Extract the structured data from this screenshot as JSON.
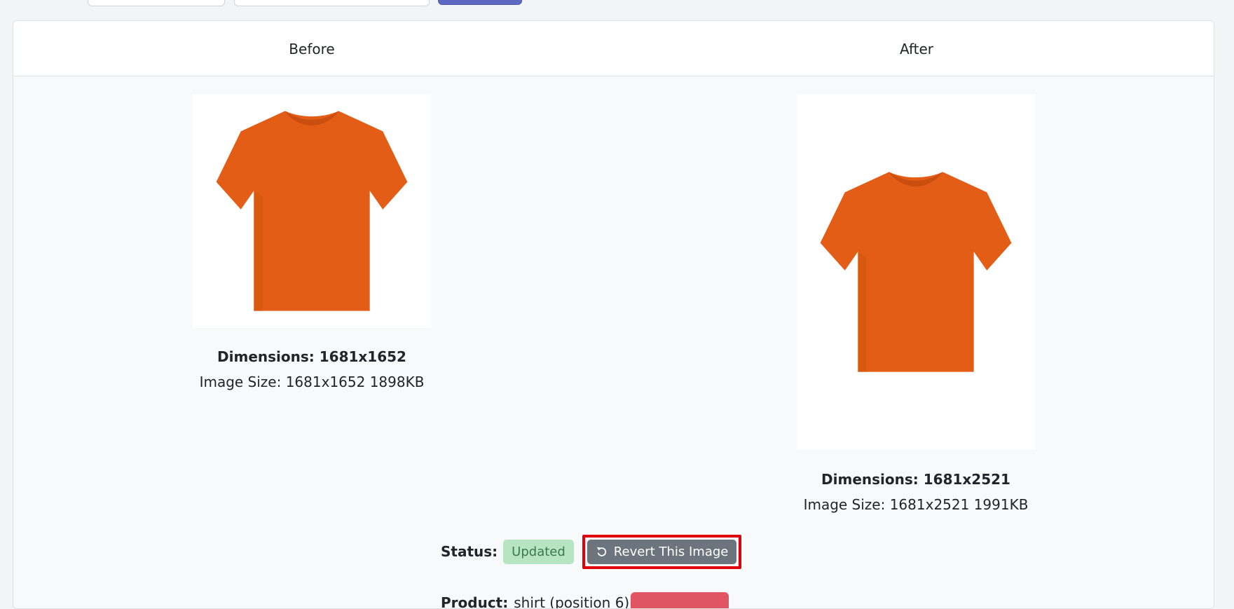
{
  "header": {
    "before_label": "Before",
    "after_label": "After"
  },
  "before": {
    "dimensions": "Dimensions: 1681x1652",
    "image_size": "Image Size: 1681x1652 1898KB"
  },
  "after": {
    "dimensions": "Dimensions: 1681x2521",
    "image_size": "Image Size: 1681x2521 1991KB"
  },
  "status": {
    "label": "Status:",
    "badge": "Updated",
    "revert_button": "Revert This Image"
  },
  "product": {
    "label": "Product:",
    "value": "shirt (position 6)"
  },
  "colors": {
    "shirt": "#e35d16",
    "badge_bg": "#b7e4c2",
    "revert_bg": "#6c757d",
    "highlight": "#e0000b"
  }
}
